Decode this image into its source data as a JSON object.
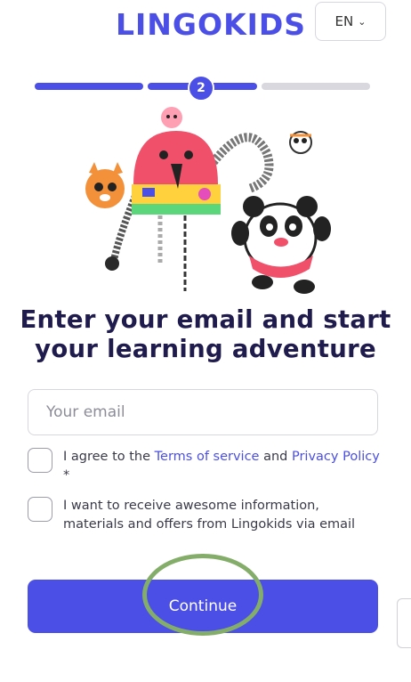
{
  "header": {
    "logo": "LINGOKIDS",
    "language": "EN",
    "language_chevron": "chevron-down-icon"
  },
  "progress": {
    "current_step": "2",
    "total_steps": 3
  },
  "heading": {
    "line1": "Enter your email and start",
    "line2": "your learning adventure"
  },
  "email": {
    "placeholder": "Your email",
    "value": ""
  },
  "consent": {
    "terms_prefix": "I agree to the ",
    "terms_link": "Terms of service",
    "terms_and": " and ",
    "privacy_link": "Privacy Policy",
    "terms_suffix": " *",
    "marketing": "I want to receive awesome information, materials and offers from Lingokids via email"
  },
  "actions": {
    "continue_label": "Continue"
  },
  "colors": {
    "brand": "#4b4fe6",
    "heading": "#1f1b4d",
    "annotation_ring": "#84ad69"
  }
}
